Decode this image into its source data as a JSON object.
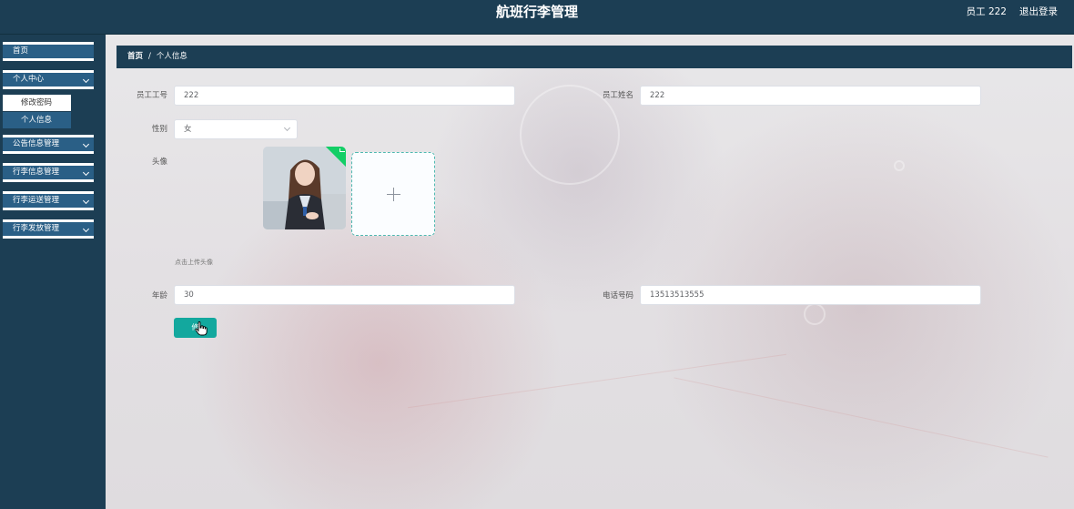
{
  "header": {
    "title": "航班行李管理",
    "user": "员工 222",
    "logout": "退出登录"
  },
  "sidebar": {
    "items": [
      {
        "label": "首页"
      },
      {
        "label": "个人中心"
      },
      {
        "label": "公告信息管理"
      },
      {
        "label": "行李信息管理"
      },
      {
        "label": "行李运送管理"
      },
      {
        "label": "行李发放管理"
      }
    ],
    "submenu": [
      {
        "label": "修改密码"
      },
      {
        "label": "个人信息"
      }
    ]
  },
  "breadcrumb": {
    "home": "首页",
    "separator": "/",
    "current": "个人信息"
  },
  "form": {
    "employee_id": {
      "label": "员工工号",
      "value": "222"
    },
    "employee_name": {
      "label": "员工姓名",
      "value": "222"
    },
    "gender": {
      "label": "性别",
      "value": "女"
    },
    "avatar": {
      "label": "头像",
      "hint": "点击上传头像"
    },
    "age": {
      "label": "年龄",
      "value": "30"
    },
    "phone": {
      "label": "电话号码",
      "value": "13513513555"
    },
    "submit_label": "修"
  },
  "colors": {
    "primary": "#1c3e54",
    "menu": "#2a5f86",
    "button": "#13a89e",
    "success_badge": "#13ce66"
  }
}
